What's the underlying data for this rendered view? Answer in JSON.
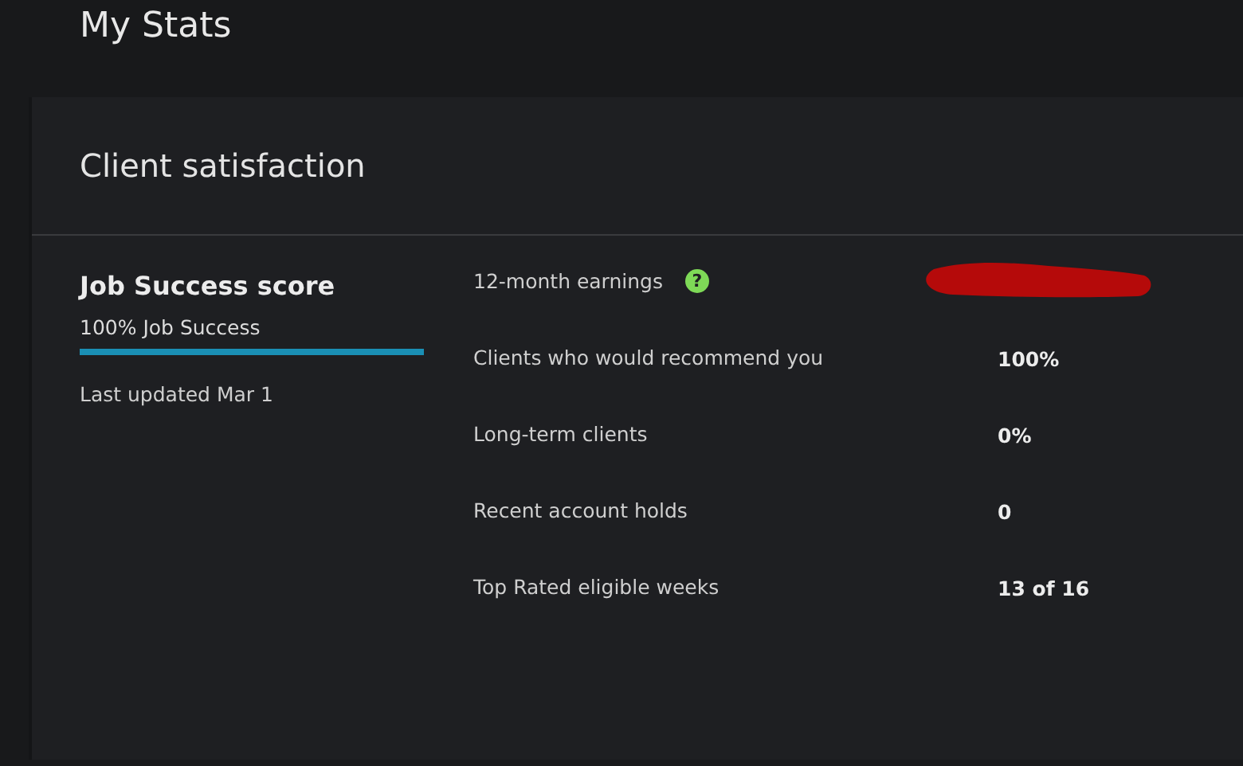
{
  "page": {
    "title": "My Stats"
  },
  "card": {
    "title": "Client satisfaction",
    "score": {
      "title": "Job Success score",
      "label": "100% Job Success",
      "level": 1.0,
      "updated": "Last updated Mar 1"
    },
    "stats": [
      {
        "kind": "redacted",
        "label": "12-month earnings",
        "hint": "?"
      },
      {
        "kind": "value",
        "label": "Clients who would recommend you",
        "value": "100%"
      },
      {
        "kind": "value",
        "label": "Long-term clients",
        "value": "0%"
      },
      {
        "kind": "value",
        "label": "Recent account holds",
        "value": "0"
      },
      {
        "kind": "value",
        "label": "Top Rated eligible weeks",
        "value": "13 of 16"
      }
    ]
  }
}
